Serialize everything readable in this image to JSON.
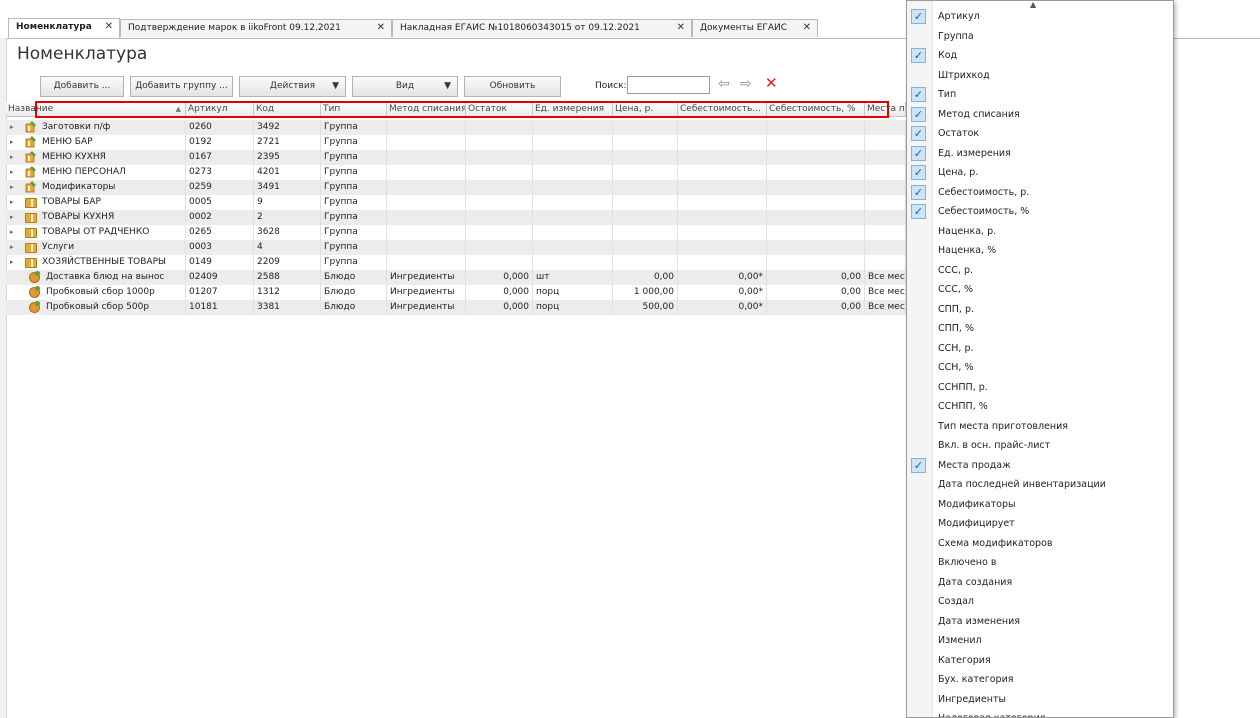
{
  "tabs": [
    {
      "label": "Номенклатура",
      "active": true
    },
    {
      "label": "Подтверждение марок в iikoFront 09.12.2021",
      "active": false
    },
    {
      "label": "Накладная ЕГАИС №1018060343015 от 09.12.2021",
      "active": false
    },
    {
      "label": "Документы ЕГАИС",
      "active": false
    }
  ],
  "close_glyph": "✕",
  "page_title": "Номенклатура",
  "toolbar": {
    "add_label": "Добавить ...",
    "add_group_label": "Добавить группу ...",
    "actions_label": "Действия",
    "view_label": "Вид",
    "refresh_label": "Обновить",
    "search_label": "Поиск:",
    "search_value": ""
  },
  "icons": {
    "dropdown": "▼",
    "back": "⇦",
    "forward": "⇨",
    "clear": "✕",
    "expander": "▸",
    "sort_asc": "▲",
    "check": "✓"
  },
  "columns": [
    "Название",
    "Артикул",
    "Код",
    "Тип",
    "Метод списания",
    "Остаток",
    "Ед. измерения",
    "Цена, р.",
    "Себестоимость...",
    "Себестоимость, %",
    "Места п"
  ],
  "rows": [
    {
      "name": "Заготовки п/ф",
      "article": "0260",
      "code": "3492",
      "type": "Группа",
      "kind": "menu"
    },
    {
      "name": "МЕНЮ БАР",
      "article": "0192",
      "code": "2721",
      "type": "Группа",
      "kind": "menu"
    },
    {
      "name": "МЕНЮ КУХНЯ",
      "article": "0167",
      "code": "2395",
      "type": "Группа",
      "kind": "menu"
    },
    {
      "name": "МЕНЮ ПЕРСОНАЛ",
      "article": "0273",
      "code": "4201",
      "type": "Группа",
      "kind": "menu"
    },
    {
      "name": "Модификаторы",
      "article": "0259",
      "code": "3491",
      "type": "Группа",
      "kind": "menu"
    },
    {
      "name": "ТОВАРЫ БАР",
      "article": "0005",
      "code": "9",
      "type": "Группа",
      "kind": "folder"
    },
    {
      "name": "ТОВАРЫ КУХНЯ",
      "article": "0002",
      "code": "2",
      "type": "Группа",
      "kind": "folder"
    },
    {
      "name": "ТОВАРЫ ОТ РАДЧЕНКО",
      "article": "0265",
      "code": "3628",
      "type": "Группа",
      "kind": "folder"
    },
    {
      "name": "Услуги",
      "article": "0003",
      "code": "4",
      "type": "Группа",
      "kind": "folder"
    },
    {
      "name": "ХОЗЯЙСТВЕННЫЕ ТОВАРЫ",
      "article": "0149",
      "code": "2209",
      "type": "Группа",
      "kind": "folder"
    },
    {
      "name": "Доставка блюд на вынос",
      "article": "02409",
      "code": "2588",
      "type": "Блюдо",
      "kind": "dish",
      "method": "Ингредиенты",
      "stock": "0,000",
      "unit": "шт",
      "price": "0,00",
      "cost": "0,00*",
      "cost_pct": "0,00",
      "places": "Все мест"
    },
    {
      "name": "Пробковый сбор 1000р",
      "article": "01207",
      "code": "1312",
      "type": "Блюдо",
      "kind": "dish",
      "method": "Ингредиенты",
      "stock": "0,000",
      "unit": "порц",
      "price": "1 000,00",
      "cost": "0,00*",
      "cost_pct": "0,00",
      "places": "Все мест"
    },
    {
      "name": "Пробковый сбор 500р",
      "article": "10181",
      "code": "3381",
      "type": "Блюдо",
      "kind": "dish",
      "method": "Ингредиенты",
      "stock": "0,000",
      "unit": "порц",
      "price": "500,00",
      "cost": "0,00*",
      "cost_pct": "0,00",
      "places": "Все мест"
    }
  ],
  "column_menu": [
    {
      "label": "Артикул",
      "checked": true
    },
    {
      "label": "Группа",
      "checked": false
    },
    {
      "label": "Код",
      "checked": true
    },
    {
      "label": "Штрихкод",
      "checked": false
    },
    {
      "label": "Тип",
      "checked": true
    },
    {
      "label": "Метод списания",
      "checked": true
    },
    {
      "label": "Остаток",
      "checked": true
    },
    {
      "label": "Ед. измерения",
      "checked": true
    },
    {
      "label": "Цена, р.",
      "checked": true
    },
    {
      "label": "Себестоимость, р.",
      "checked": true
    },
    {
      "label": "Себестоимость, %",
      "checked": true
    },
    {
      "label": "Наценка, р.",
      "checked": false
    },
    {
      "label": "Наценка, %",
      "checked": false
    },
    {
      "label": "ССС, р.",
      "checked": false
    },
    {
      "label": "ССС, %",
      "checked": false
    },
    {
      "label": "СПП, р.",
      "checked": false
    },
    {
      "label": "СПП, %",
      "checked": false
    },
    {
      "label": "ССН, р.",
      "checked": false
    },
    {
      "label": "ССН, %",
      "checked": false
    },
    {
      "label": "ССНПП, р.",
      "checked": false
    },
    {
      "label": "ССНПП, %",
      "checked": false
    },
    {
      "label": "Тип места приготовления",
      "checked": false
    },
    {
      "label": "Вкл. в осн. прайс-лист",
      "checked": false
    },
    {
      "label": "Места продаж",
      "checked": true
    },
    {
      "label": "Дата последней инвентаризации",
      "checked": false
    },
    {
      "label": "Модификаторы",
      "checked": false
    },
    {
      "label": "Модифицирует",
      "checked": false
    },
    {
      "label": "Схема модификаторов",
      "checked": false
    },
    {
      "label": "Включено в",
      "checked": false
    },
    {
      "label": "Дата создания",
      "checked": false
    },
    {
      "label": "Создал",
      "checked": false
    },
    {
      "label": "Дата изменения",
      "checked": false
    },
    {
      "label": "Изменил",
      "checked": false
    },
    {
      "label": "Категория",
      "checked": false
    },
    {
      "label": "Бух. категория",
      "checked": false
    },
    {
      "label": "Ингредиенты",
      "checked": false
    },
    {
      "label": "Налоговая категория",
      "checked": false
    }
  ]
}
